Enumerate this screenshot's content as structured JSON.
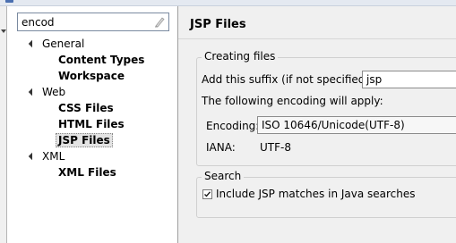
{
  "filter": {
    "value": "encod"
  },
  "tree": [
    {
      "label": "General",
      "children": [
        "Content Types",
        "Workspace"
      ]
    },
    {
      "label": "Web",
      "children": [
        "CSS Files",
        "HTML Files",
        "JSP Files"
      ]
    },
    {
      "label": "XML",
      "children": [
        "XML Files"
      ]
    }
  ],
  "selected": "JSP Files",
  "page": {
    "title": "JSP Files"
  },
  "creating_files": {
    "group_label": "Creating files",
    "suffix_label": "Add this suffix (if not specified):",
    "suffix_value": "jsp",
    "encoding_note": "The following encoding will apply:",
    "encoding_label": "Encoding:",
    "encoding_value": "ISO 10646/Unicode(UTF-8)",
    "iana_label": "IANA:",
    "iana_value": "UTF-8"
  },
  "search": {
    "group_label": "Search",
    "include_label": "Include JSP matches in Java searches",
    "include_checked": true
  }
}
